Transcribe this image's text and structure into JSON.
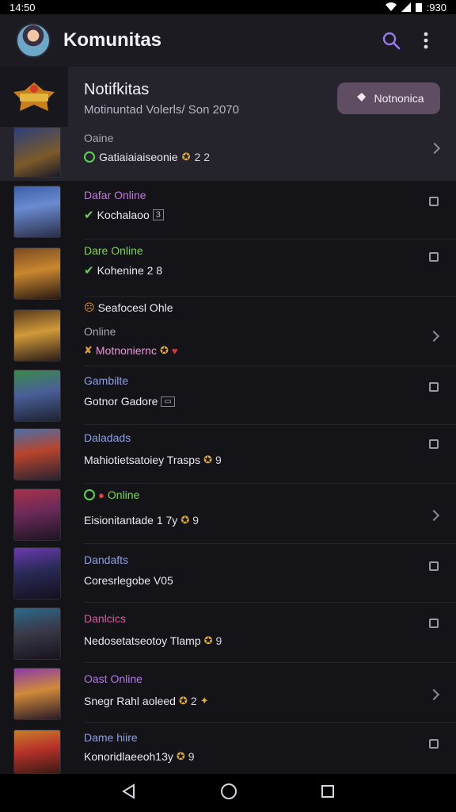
{
  "status_bar": {
    "time": "14:50",
    "right_text": ":930"
  },
  "app_bar": {
    "title": "Komunitas"
  },
  "banner": {
    "title": "Notifkitas",
    "subtitle": "Motinuntad Volerls/ Son 2070",
    "button_label": "Notnonica"
  },
  "rows": [
    {
      "status": "Oaine",
      "name": "Gatiaiaiaiseonie",
      "extra": "2   2",
      "status_color": "#a9a5b4"
    },
    {
      "status": "Dafar Online",
      "name": "Kochalaoo",
      "extra": "3",
      "status_color": "#c07ad8"
    },
    {
      "status": "Dare Online",
      "name": "Kohenine 2 8",
      "extra": "",
      "status_color": "#7fd35a"
    },
    {
      "status": "Online",
      "header": "Seafocesl Ohle",
      "name": "Motnoniernc",
      "extra": "",
      "status_color": "#a9a5b4"
    },
    {
      "status": "Gambilte",
      "name": "Gotnor Gadore",
      "extra": "",
      "status_color": "#8fa0e0"
    },
    {
      "status": "Daladads",
      "name": "Mahiotietsatoiey Trasps",
      "extra": "9",
      "status_color": "#8fa0e0"
    },
    {
      "status": "Online",
      "name": "Eisionitantade 1 7y",
      "extra": "9",
      "status_color": "#7fd35a"
    },
    {
      "status": "Dandafts",
      "name": "Coresrlegobe V05",
      "extra": "",
      "status_color": "#8fa0e0"
    },
    {
      "status": "Danlcics",
      "name": "Nedosetatseotoy Tlamp",
      "extra": "9",
      "status_color": "#d15ea0"
    },
    {
      "status": "Oast Online",
      "name": "Snegr Rahl aoleed",
      "extra": "2",
      "status_color": "#b07ae0"
    },
    {
      "status": "Dame hiire",
      "name": "Konoridlaeeoh13y",
      "extra": "9",
      "status_color": "#8fa0e0"
    }
  ],
  "colors": {
    "accent": "#9a7cf0",
    "background": "#141318",
    "banner_bg": "#25232c",
    "button_bg": "#5f4d63"
  }
}
